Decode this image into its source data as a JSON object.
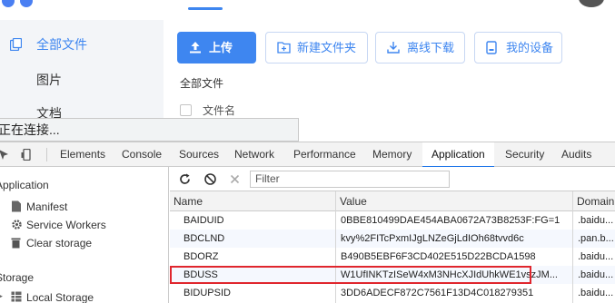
{
  "web": {
    "nav": [
      {
        "label": "全部文件",
        "active": true,
        "icon": "folder-icon"
      },
      {
        "label": "图片",
        "active": false
      },
      {
        "label": "文档",
        "active": false
      }
    ],
    "buttons": {
      "upload": "上传",
      "new_folder": "新建文件夹",
      "offline_download": "离线下载",
      "my_devices": "我的设备"
    },
    "breadcrumb": "全部文件",
    "column_filename": "文件名",
    "accent_color": "#3e86f0"
  },
  "status_text": "正在连接...",
  "devtools": {
    "tabs": [
      "Elements",
      "Console",
      "Sources",
      "Network",
      "Performance",
      "Memory",
      "Application",
      "Security",
      "Audits"
    ],
    "active_tab": "Application",
    "sidebar": {
      "application_section": "Application",
      "manifest": "Manifest",
      "service_workers": "Service Workers",
      "clear_storage": "Clear storage",
      "storage_section": "Storage",
      "local_storage": "Local Storage"
    },
    "filter_placeholder": "Filter",
    "columns": [
      "Name",
      "Value",
      "Domain"
    ],
    "cookies": [
      {
        "name": "BAIDUID",
        "value": "0BBE810499DAE454ABA0672A73B8253F:FG=1",
        "domain": ".baidu..."
      },
      {
        "name": "BDCLND",
        "value": "kvy%2FITcPxmIJgLNZeGjLdIOh68tvvd6c",
        "domain": ".pan.b..."
      },
      {
        "name": "BDORZ",
        "value": "B490B5EBF6F3CD402E515D22BCDA1598",
        "domain": ".baidu..."
      },
      {
        "name": "BDUSS",
        "value": "W1UfINKTzISeW4xM3NHcXJIdUhkWE1v",
        "value_tail": "szJM...",
        "domain": ".baidu..."
      },
      {
        "name": "BIDUPSID",
        "value": "3DD6ADECF872C7561F13D4C018279351",
        "domain": ".baidu..."
      }
    ],
    "highlight_color": "#e0262d"
  }
}
